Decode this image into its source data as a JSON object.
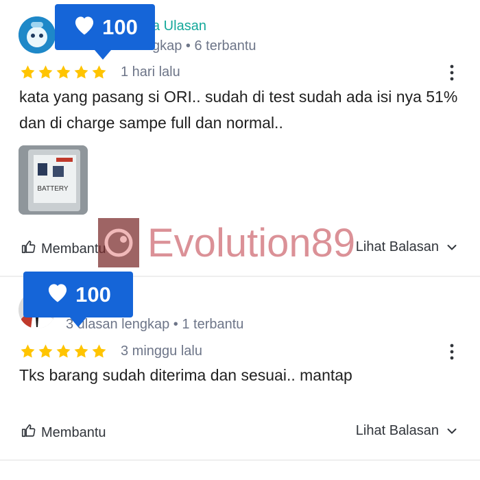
{
  "watermark": {
    "text": "Evolution89"
  },
  "reviews": [
    {
      "reviewer_link": "a Ulasan",
      "reviewer_meta": "gkap • 6 terbantu",
      "rating": 5,
      "date": "1 hari lalu",
      "text": "kata yang pasang si ORI.. sudah di test sudah ada isi nya 51% dan di charge sampe full dan normal..",
      "photo_label": "BATTERY",
      "likes": "100",
      "helpful_label": "Membantu",
      "replies_label": "Lihat Balasan"
    },
    {
      "reviewer_meta": "3 ulasan lengkap • 1 terbantu",
      "rating": 5,
      "date": "3 minggu lalu",
      "text": "Tks barang sudah diterima dan sesuai.. mantap",
      "likes": "100",
      "helpful_label": "Membantu",
      "replies_label": "Lihat Balasan"
    }
  ],
  "colors": {
    "star": "#ffc400",
    "link": "#14a89a",
    "badge": "#1565d8",
    "muted": "#6d7588"
  },
  "icons": [
    "avatar",
    "star-icon",
    "kebab-menu-icon",
    "thumbs-up-icon",
    "chevron-down-icon",
    "heart-icon"
  ]
}
